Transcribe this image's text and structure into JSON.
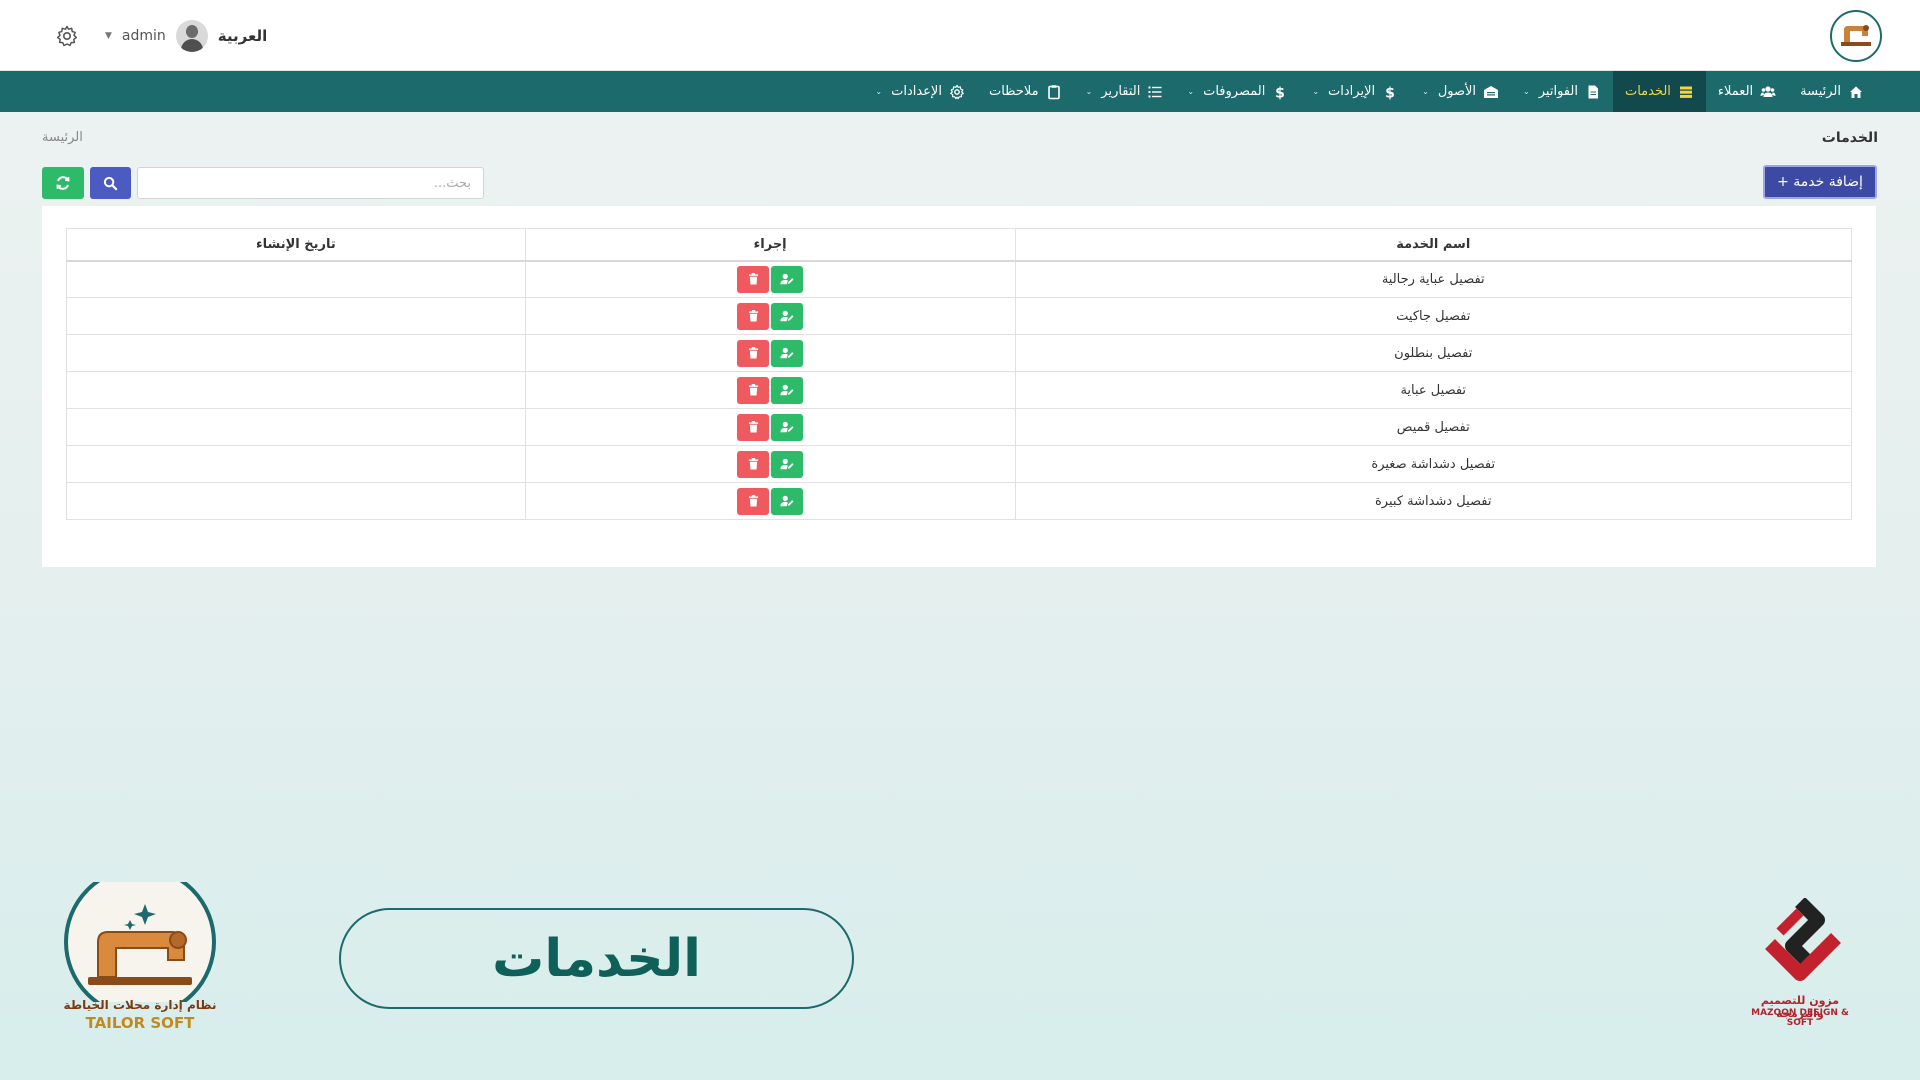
{
  "header": {
    "language_label": "العربية",
    "user_name": "admin"
  },
  "nav": {
    "items": [
      {
        "label": "الرئيسة",
        "icon": "home-icon",
        "active": false,
        "dropdown": false
      },
      {
        "label": "العملاء",
        "icon": "users-icon",
        "active": false,
        "dropdown": false
      },
      {
        "label": "الخدمات",
        "icon": "services-icon",
        "active": true,
        "dropdown": false
      },
      {
        "label": "الفواتير",
        "icon": "file-icon",
        "active": false,
        "dropdown": true
      },
      {
        "label": "الأصول",
        "icon": "warehouse-icon",
        "active": false,
        "dropdown": true
      },
      {
        "label": "الإيرادات",
        "icon": "dollar-icon",
        "active": false,
        "dropdown": true
      },
      {
        "label": "المصروفات",
        "icon": "dollar-icon",
        "active": false,
        "dropdown": true
      },
      {
        "label": "التقارير",
        "icon": "list-icon",
        "active": false,
        "dropdown": true
      },
      {
        "label": "ملاحظات",
        "icon": "clipboard-icon",
        "active": false,
        "dropdown": false
      },
      {
        "label": "الإعدادات",
        "icon": "gear-icon",
        "active": false,
        "dropdown": true
      }
    ]
  },
  "page": {
    "title": "الخدمات",
    "breadcrumb": "الرئيسة",
    "add_button_label": "إضافة خدمة +",
    "search_placeholder": "بحث..."
  },
  "table": {
    "headers": [
      "اسم الخدمة",
      "إجراء",
      "تاريخ الإنشاء"
    ],
    "rows": [
      {
        "name": "تفصيل عباية رجالية",
        "date": ""
      },
      {
        "name": "تفصيل جاكيت",
        "date": ""
      },
      {
        "name": "تفصيل بنطلون",
        "date": ""
      },
      {
        "name": "تفصيل عباية",
        "date": ""
      },
      {
        "name": "تفصيل قميص",
        "date": ""
      },
      {
        "name": "تفصيل دشداشة صغيرة",
        "date": ""
      },
      {
        "name": "تفصيل دشداشة كبيرة",
        "date": ""
      }
    ]
  },
  "decor": {
    "banner_text": "الخدمات",
    "tailor_logo_arabic": "نظام إدارة محلات الخياطة",
    "tailor_logo_english": "TAILOR SOFT",
    "mazoon_arabic": "مزون للتصميم والبرمجة",
    "mazoon_english": "MAZOON DESIGN & SOFT"
  },
  "colors": {
    "navbar": "#1d6a6c",
    "nav_active_bg": "#12494c",
    "nav_active_text": "#f2d63c",
    "primary_button": "#3d4aa3",
    "success_button": "#2dbb6a",
    "danger_button": "#ef5a5e"
  }
}
